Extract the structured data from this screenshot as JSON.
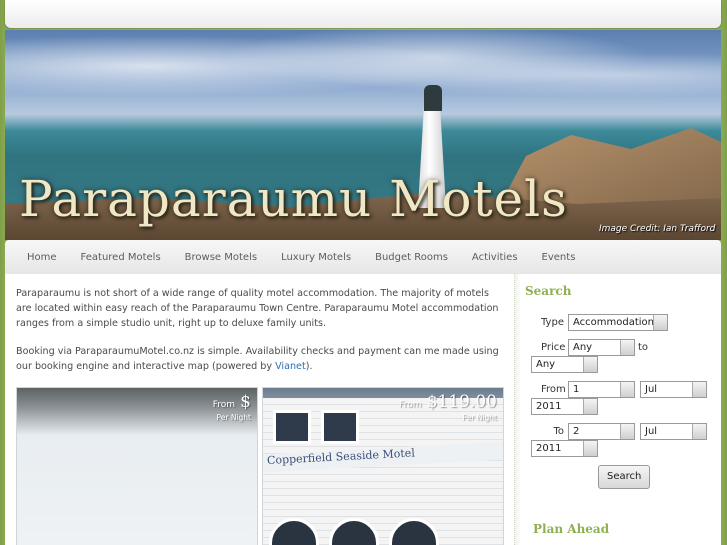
{
  "header": {
    "site_title": "Paraparaumu Motels",
    "image_credit": "Image Credit: Ian Trafford"
  },
  "nav": {
    "items": [
      "Home",
      "Featured Motels",
      "Browse Motels",
      "Luxury Motels",
      "Budget Rooms",
      "Activities",
      "Events"
    ]
  },
  "main": {
    "intro": "Paraparaumu is not short of a wide range of quality motel accommodation. The majority of motels are located within easy reach of the Paraparaumu Town Centre. Paraparaumu Motel accommodation ranges from a simple studio unit, right up to deluxe family units.",
    "booking_prefix": "Booking via ParaparaumuMotel.co.nz is simple. Availability checks and payment can me made using our booking engine and interactive map (powered by ",
    "booking_link": "Vianet",
    "booking_suffix": ")."
  },
  "cards": [
    {
      "from": "From",
      "amount": "$",
      "per": "Per Night"
    },
    {
      "from": "From",
      "amount": "$119.00",
      "per": "Per Night",
      "sign": "Copperfield Seaside Motel"
    }
  ],
  "search": {
    "heading": "Search",
    "type_label": "Type",
    "type_value": "Accommodation",
    "price_label": "Price",
    "price_min": "Any",
    "price_to": "to",
    "price_max": "Any",
    "from_label": "From",
    "from_day": "1",
    "from_month": "Jul",
    "from_year": "2011",
    "to_label": "To",
    "to_day": "2",
    "to_month": "Jul",
    "to_year": "2011",
    "button": "Search"
  },
  "plan": {
    "heading": "Plan Ahead"
  },
  "colors": {
    "accent_green": "#8fb052",
    "link_blue": "#2b6fb4",
    "title_cream": "#f0e7c4"
  }
}
